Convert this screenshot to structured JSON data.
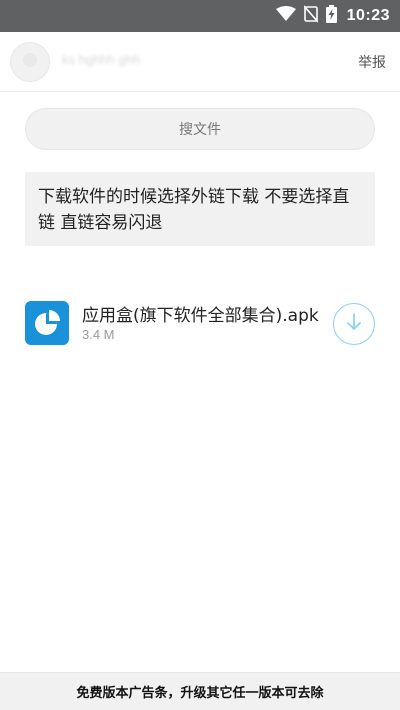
{
  "status_bar": {
    "time": "10:23",
    "icons": [
      "wifi-icon",
      "no-signal-icon",
      "battery-charging-icon"
    ]
  },
  "header": {
    "user_name": "ks hghhh ghh",
    "report_label": "举报"
  },
  "search": {
    "placeholder": "搜文件"
  },
  "notice": {
    "text": "下载软件的时候选择外链下载 不要选择直链 直链容易闪退"
  },
  "files": [
    {
      "name": "应用盒(旗下软件全部集合).apk",
      "size": "3.4 M",
      "icon": "pie-chart-app-icon",
      "action_icon": "download-icon"
    }
  ],
  "ad_banner": {
    "text": "免费版本广告条，升级其它任一版本可去除"
  },
  "colors": {
    "status_bar": "#5f6163",
    "accent": "#1a91d9",
    "download_ring": "#8fd1ee",
    "panel_bg": "#f1f1f1"
  }
}
